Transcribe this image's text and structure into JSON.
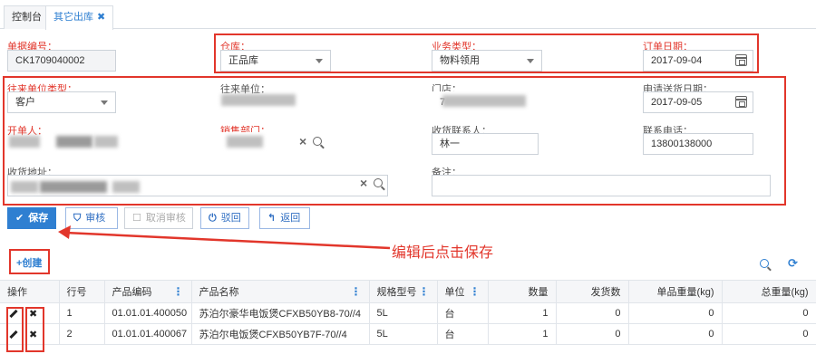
{
  "tabs": [
    {
      "label": "控制台"
    },
    {
      "label": "其它出库",
      "close": "✖"
    }
  ],
  "form": {
    "doc_no": {
      "label": "单据编号：",
      "value": "CK1709040002"
    },
    "warehouse": {
      "label": "仓库：",
      "value": "正品库"
    },
    "biz_type": {
      "label": "业务类型：",
      "value": "物料领用"
    },
    "order_date": {
      "label": "订单日期：",
      "value": "2017-09-04"
    },
    "partner_type": {
      "label": "往来单位类型：",
      "value": "客户"
    },
    "partner": {
      "label": "往来单位："
    },
    "store": {
      "label": "门店：",
      "value": "7"
    },
    "delivery_date": {
      "label": "申请送货日期：",
      "value": "2017-09-05"
    },
    "creator": {
      "label": "开单人："
    },
    "sales_dept": {
      "label": "销售部门："
    },
    "receiver": {
      "label": "收货联系人：",
      "value": "林一"
    },
    "phone": {
      "label": "联系电话：",
      "value": "13800138000"
    },
    "address": {
      "label": "收货地址："
    },
    "remark": {
      "label": "备注：",
      "value": ""
    }
  },
  "toolbar": {
    "save": "保存",
    "audit": "审核",
    "unaudit": "取消审核",
    "reject": "驳回",
    "back": "返回"
  },
  "annotation": "编辑后点击保存",
  "create_label": "+创建",
  "table": {
    "headers": [
      "操作",
      "行号",
      "产品编码",
      "产品名称",
      "规格型号",
      "单位",
      "数量",
      "发货数",
      "单品重量(kg)",
      "总重量(kg)"
    ],
    "rows": [
      {
        "line": "1",
        "code": "01.01.01.400050",
        "name": "苏泊尔豪华电饭煲CFXB50YB8-70//4",
        "spec": "5L",
        "unit": "台",
        "qty": "1",
        "shipped": "0",
        "unit_weight": "0",
        "total_weight": "0"
      },
      {
        "line": "2",
        "code": "01.01.01.400067",
        "name": "苏泊尔电饭煲CFXB50YB7F-70//4",
        "spec": "5L",
        "unit": "台",
        "qty": "1",
        "shipped": "0",
        "unit_weight": "0",
        "total_weight": "0"
      }
    ]
  },
  "colors": {
    "accent": "#2f7fd1",
    "highlight": "#e2362b",
    "required": "#e2362b"
  },
  "icons": [
    "close-icon",
    "caret-down-icon",
    "calendar-icon",
    "clear-icon",
    "search-icon",
    "check-icon",
    "shield-icon",
    "undo-icon",
    "power-icon",
    "reply-icon",
    "edit-icon",
    "delete-icon",
    "refresh-icon"
  ]
}
